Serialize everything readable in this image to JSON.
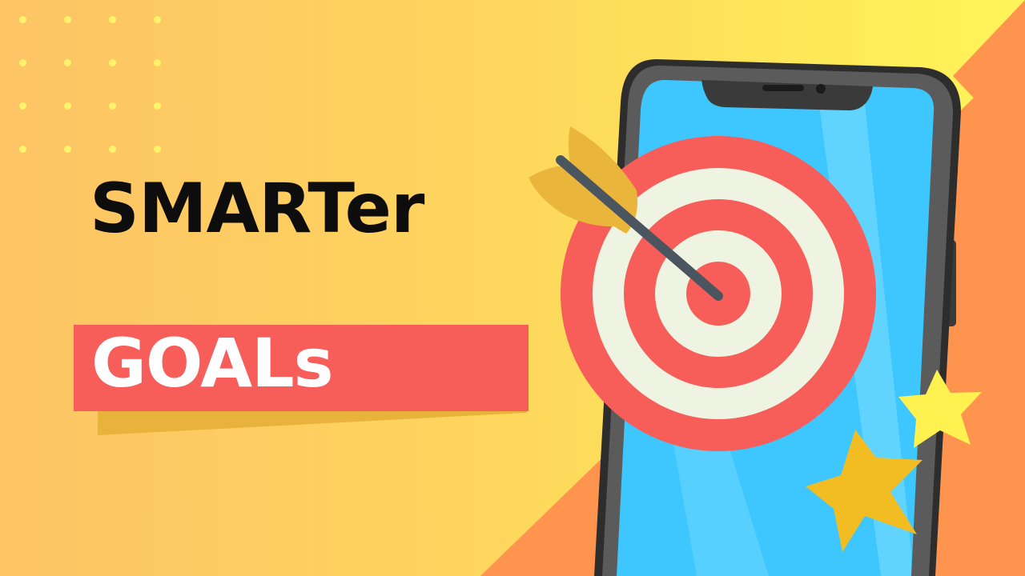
{
  "title": {
    "line1": "SMARTer",
    "line2": "GOALs"
  },
  "colors": {
    "background_left": "#fdc466",
    "background_right": "#fff45a",
    "orange_triangles": "#fe944d",
    "banner_red": "#f75d59",
    "banner_shadow": "#e7b33a",
    "target_red": "#f75d59",
    "target_cream": "#eef3e2",
    "phone_screen": "#3ec6ff",
    "phone_frame": "#505050",
    "star_light": "#fef150",
    "star_dark": "#f2bd22",
    "arrow_shaft": "#4a5560",
    "arrow_fletching": "#e9b53a"
  },
  "icons": [
    "dot-grid-decoration",
    "smartphone-icon",
    "target-icon",
    "arrow-icon",
    "star-icon"
  ]
}
